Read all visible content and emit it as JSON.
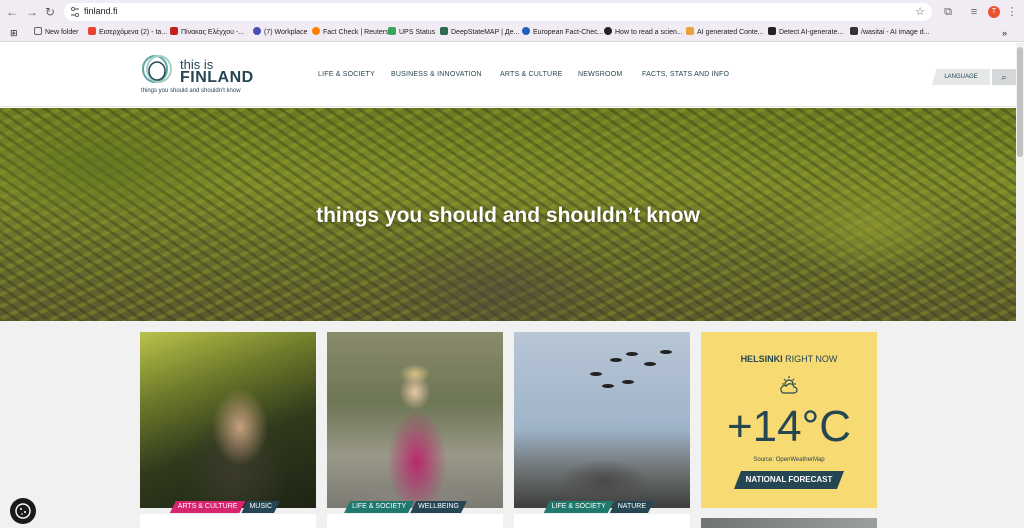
{
  "browser": {
    "url": "finland.fi",
    "bookmarks": [
      {
        "label": "New folder",
        "color": "#5f6368"
      },
      {
        "label": "Εισερχόμενα (2) - ta...",
        "color": "#ea4335"
      },
      {
        "label": "Πίνακας Ελέγχου -...",
        "color": "#c5221f"
      },
      {
        "label": "(7) Workplace",
        "color": "#4a4fb8"
      },
      {
        "label": "Fact Check | Reuters",
        "color": "#ff8000"
      },
      {
        "label": "UPS Status",
        "color": "#3ba55c"
      },
      {
        "label": "DeepStateMAP | Де...",
        "color": "#2d6a4f"
      },
      {
        "label": "European Fact-Chec...",
        "color": "#1f5fbf"
      },
      {
        "label": "How to read a scien...",
        "color": "#202124"
      },
      {
        "label": "AI generated Conte...",
        "color": "#e9a23b"
      },
      {
        "label": "Detect AI-generate...",
        "color": "#222"
      },
      {
        "label": "/wasitai - AI image d...",
        "color": "#333"
      }
    ],
    "profile_initial": "T"
  },
  "header": {
    "logo_top": "this is",
    "logo_main": "FINLAND",
    "logo_tagline": "things you should and shouldn't know",
    "nav": [
      "LIFE & SOCIETY",
      "BUSINESS & INNOVATION",
      "ARTS & CULTURE",
      "NEWSROOM",
      "FACTS, STATS AND INFO"
    ],
    "language_label": "LANGUAGE"
  },
  "hero": {
    "title": "things you should and shouldn’t know"
  },
  "cards": [
    {
      "tags": [
        {
          "label": "ARTS & CULTURE",
          "color": "#d6246e"
        },
        {
          "label": "MUSIC",
          "color": "#264653"
        }
      ]
    },
    {
      "tags": [
        {
          "label": "LIFE & SOCIETY",
          "color": "#1f7a6d"
        },
        {
          "label": "WELLBEING",
          "color": "#264653"
        }
      ]
    },
    {
      "tags": [
        {
          "label": "LIFE & SOCIETY",
          "color": "#1f7a6d"
        },
        {
          "label": "NATURE",
          "color": "#264653"
        }
      ]
    }
  ],
  "weather": {
    "city": "HELSINKI",
    "suffix": "RIGHT NOW",
    "temperature": "+14°C",
    "source": "Source: OpenWeatherMap",
    "button": "NATIONAL FORECAST",
    "icon": "partly-cloudy-icon"
  },
  "colors": {
    "brand": "#264653",
    "weather_bg": "#f7da72",
    "arts_tag": "#d6246e",
    "life_tag": "#1f7a6d"
  }
}
